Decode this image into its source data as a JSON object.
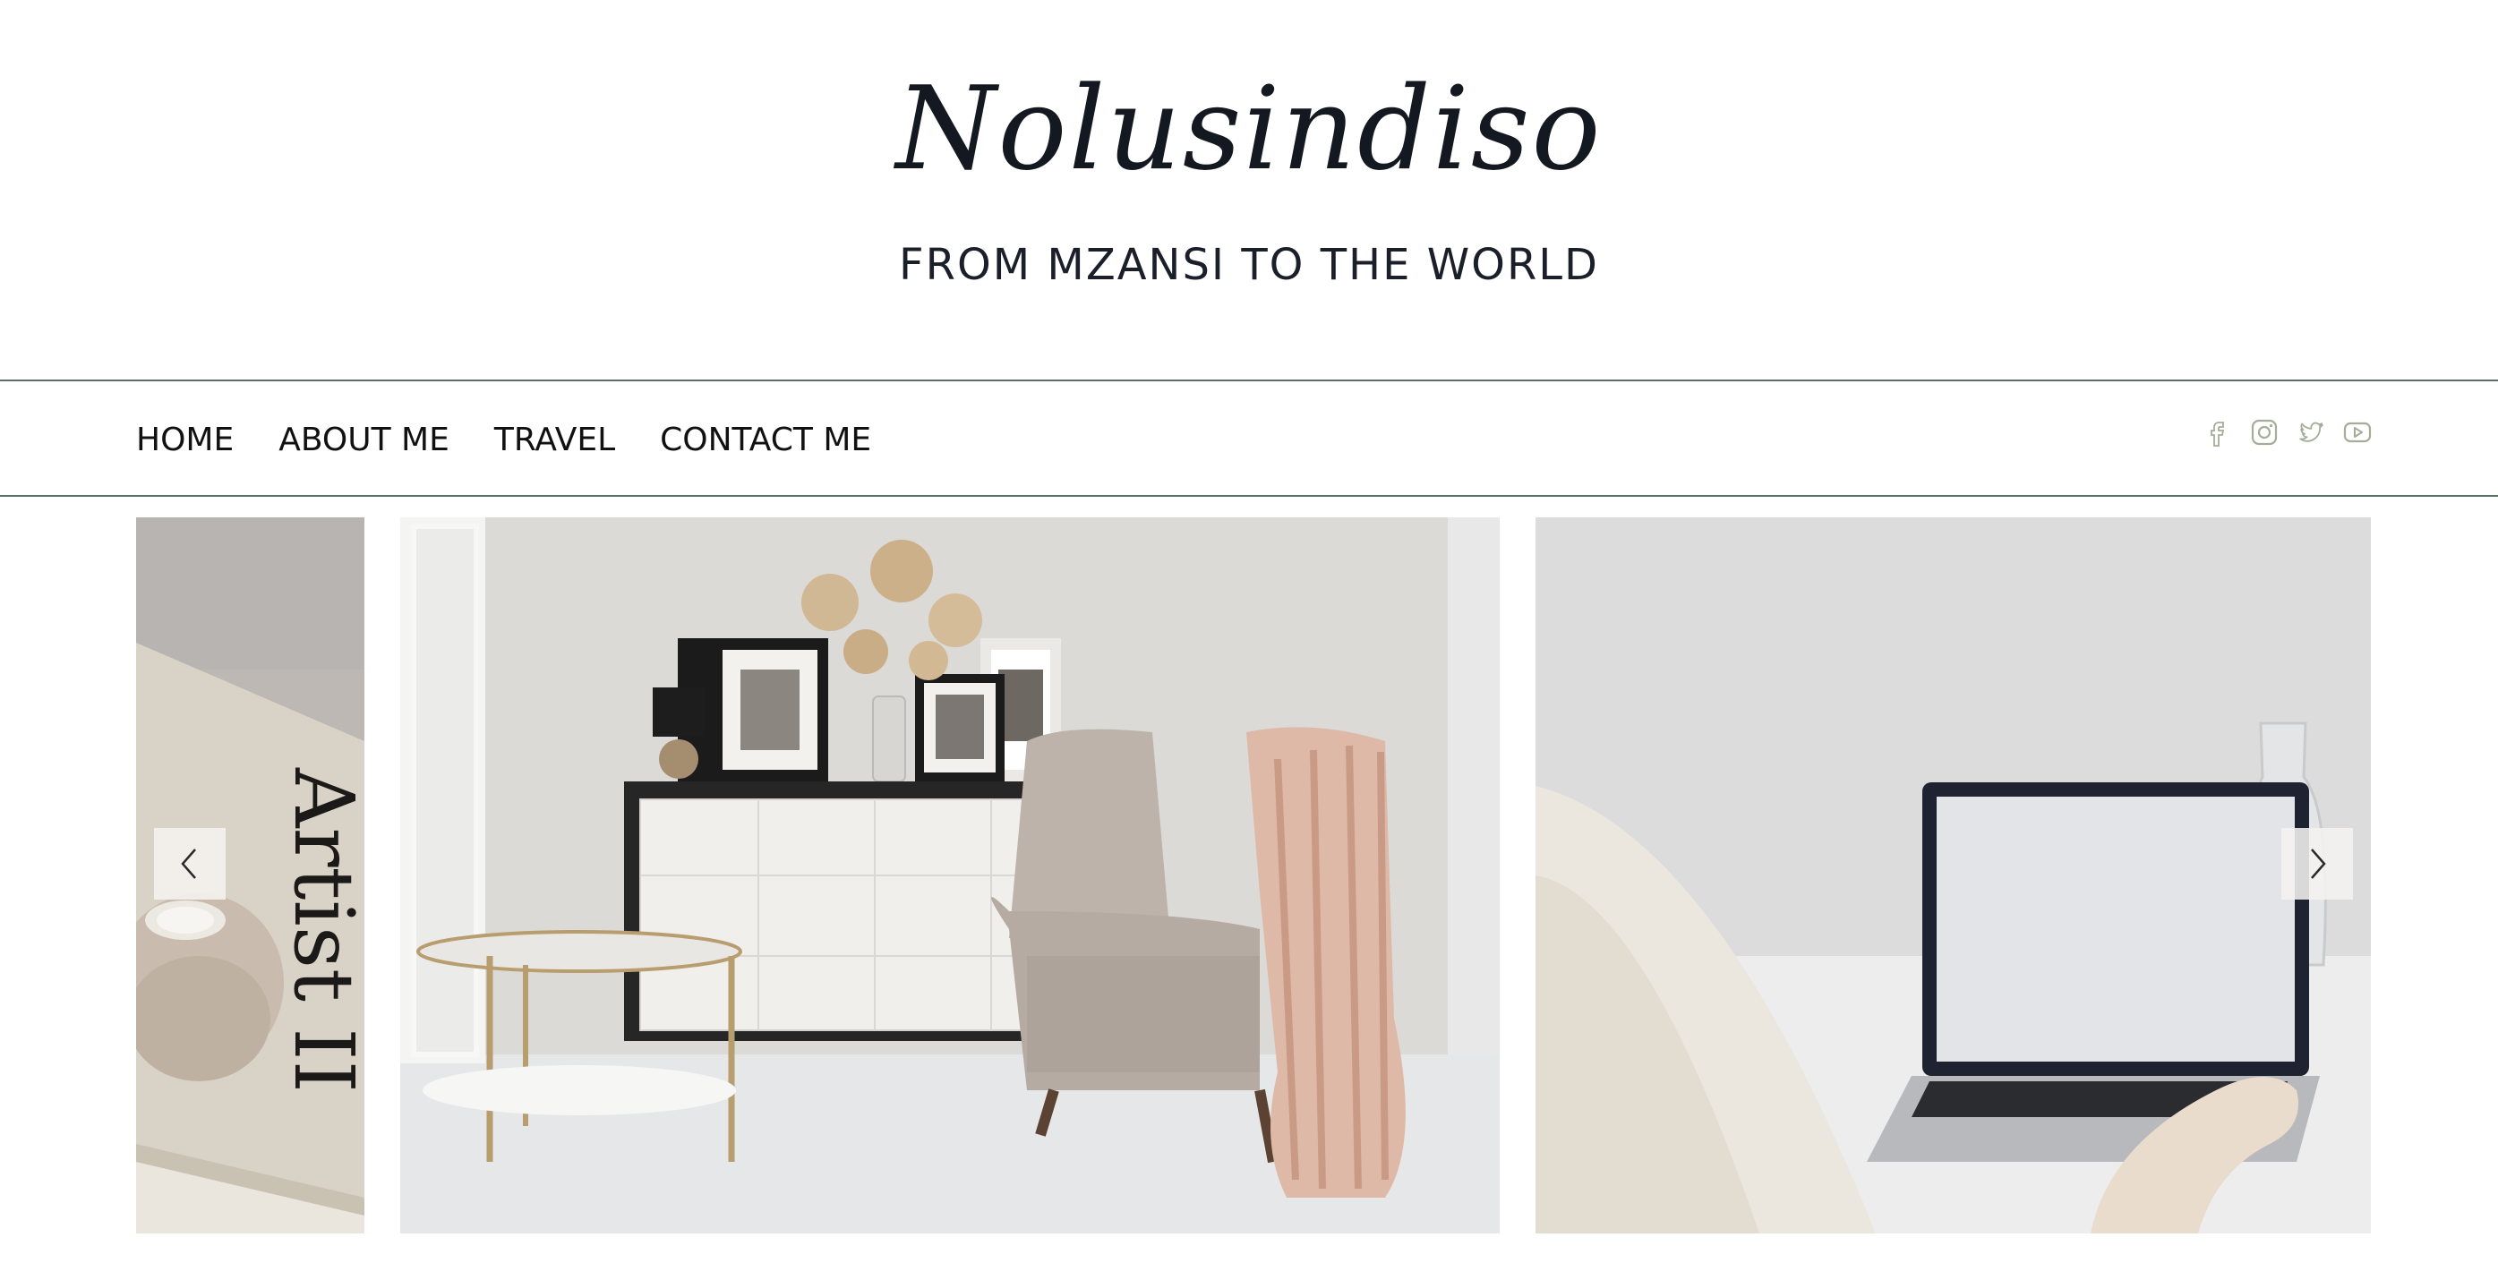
{
  "site": {
    "title": "Nolusindiso",
    "tagline": "FROM MZANSI TO THE WORLD"
  },
  "nav": {
    "items": [
      {
        "label": "HOME"
      },
      {
        "label": "ABOUT ME"
      },
      {
        "label": "TRAVEL"
      },
      {
        "label": "CONTACT ME"
      }
    ]
  },
  "social": {
    "color": "#a5ad98",
    "icons": [
      "facebook-icon",
      "instagram-icon",
      "twitter-icon",
      "youtube-icon"
    ]
  },
  "gallery": {
    "slides": [
      {
        "name": "book-and-candle-photo",
        "book_text": "Artist II"
      },
      {
        "name": "living-room-photo"
      },
      {
        "name": "laptop-desk-photo"
      }
    ],
    "prev_icon": "chevron-left-icon",
    "next_icon": "chevron-right-icon"
  },
  "colors": {
    "text_dark": "#141821",
    "divider": "#5d6f62",
    "accent_social": "#a5ad98"
  }
}
